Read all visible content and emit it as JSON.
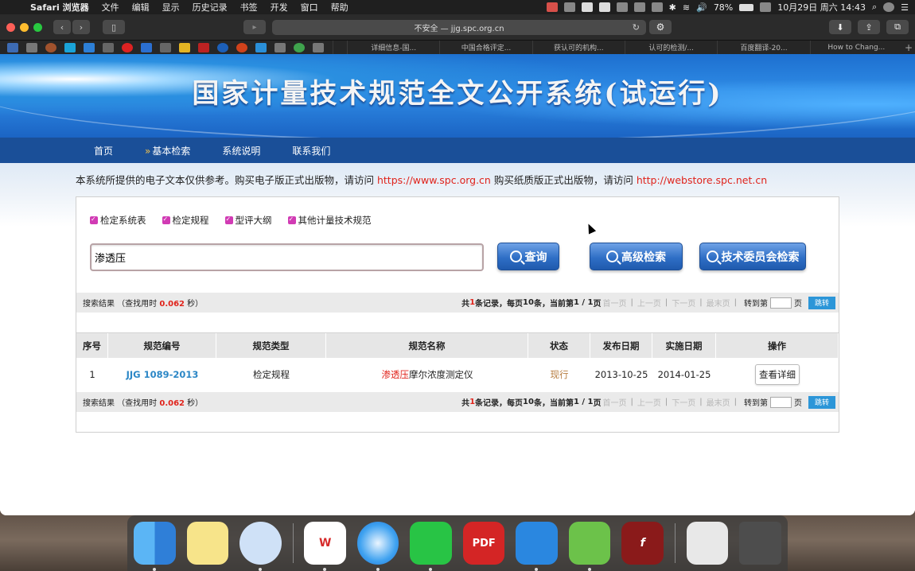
{
  "menubar": {
    "app_name": "Safari 浏览器",
    "items": [
      "文件",
      "编辑",
      "显示",
      "历史记录",
      "书签",
      "开发",
      "窗口",
      "帮助"
    ],
    "battery": "78%",
    "datetime": "10月29日 周六 14:43"
  },
  "browser": {
    "url": "不安全 — jjg.spc.org.cn",
    "tabs": [
      "详细信息-国...",
      "中国合格评定...",
      "获认可的机构...",
      "认可的检测/...",
      "百度翻译-20...",
      "How to Chang..."
    ]
  },
  "site": {
    "banner_title": "国家计量技术规范全文公开系统(试运行)",
    "nav": [
      "首页",
      "基本检索",
      "系统说明",
      "联系我们"
    ],
    "notice_pre": "本系统所提供的电子文本仅供参考。购买电子版正式出版物，请访问 ",
    "notice_link1": "https://www.spc.org.cn",
    "notice_mid": " 购买纸质版正式出版物，请访问 ",
    "notice_link2": "http://webstore.spc.net.cn"
  },
  "search": {
    "checkboxes": [
      "检定系统表",
      "检定规程",
      "型评大纲",
      "其他计量技术规范"
    ],
    "query": "渗透压",
    "btn_query": "查询",
    "btn_advanced": "高级检索",
    "btn_committee": "技术委员会检索"
  },
  "results": {
    "summary_label": "搜索结果 （查找用时 ",
    "time": "0.062",
    "time_unit": " 秒）",
    "total_pre": "共",
    "total": "1",
    "total_mid": " 条记录，每页 ",
    "per_page": "10",
    "page_mid": " 条，当前第 ",
    "page_info": "1 / 1",
    "page_suffix": " 页",
    "first": "首一页",
    "prev": "上一页",
    "next": "下一页",
    "last": "最末页",
    "jump_label": "转到第",
    "jump_suffix": "页",
    "go": "跳转"
  },
  "table": {
    "headers": [
      "序号",
      "规范编号",
      "规范类型",
      "规范名称",
      "状态",
      "发布日期",
      "实施日期",
      "操作"
    ],
    "rows": [
      {
        "no": "1",
        "code": "JJG 1089-2013",
        "type": "检定规程",
        "name_hl": "渗透压",
        "name_rest": "摩尔浓度测定仪",
        "status": "现行",
        "publish": "2013-10-25",
        "implement": "2014-01-25",
        "action": "查看详细"
      }
    ]
  }
}
